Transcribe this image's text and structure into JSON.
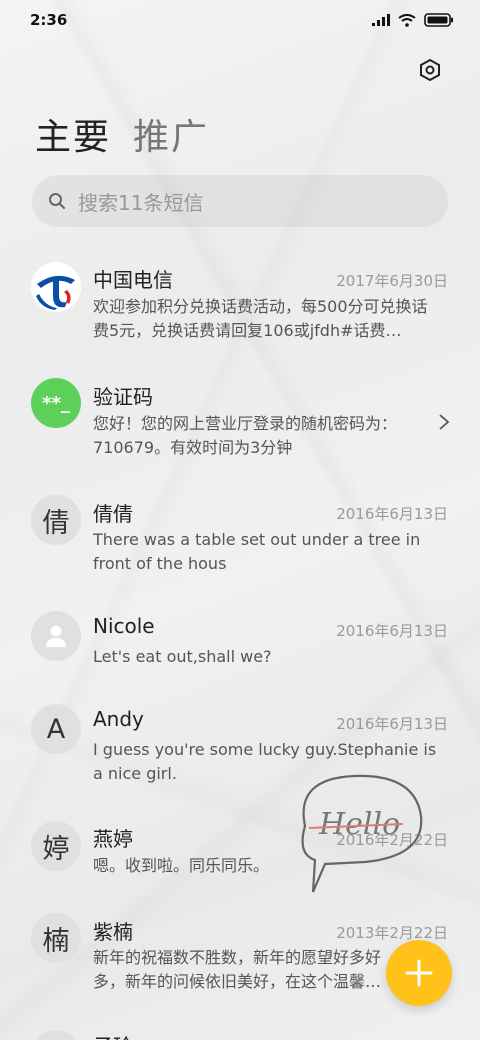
{
  "status_bar": {
    "time": "2:36"
  },
  "header": {
    "tabs": [
      {
        "label": "主要",
        "active": true
      },
      {
        "label": "推广",
        "active": false
      }
    ],
    "settings_icon": "settings-hexagon-icon"
  },
  "search": {
    "placeholder": "搜索11条短信"
  },
  "conversations": [
    {
      "name": "中国电信",
      "date": "2017年6月30日",
      "preview": "欢迎参加积分兑换话费活动，每500分可兑换话费5元，兑换话费请回复106或jfdh#话费…",
      "avatar": "china-telecom-logo"
    },
    {
      "name": "验证码",
      "date": "",
      "preview": "您好！您的网上营业厅登录的随机密码为：710679。有效时间为3分钟",
      "avatar_text": "**_",
      "avatar_color": "#5dd05a"
    },
    {
      "name": "倩倩",
      "date": "2016年6月13日",
      "preview": "There was a table set out under a tree in front of the hous",
      "avatar_text": "倩"
    },
    {
      "name": "Nicole",
      "date": "2016年6月13日",
      "preview": "Let's eat out,shall we?",
      "avatar": "person-icon"
    },
    {
      "name": "Andy",
      "date": "2016年6月13日",
      "preview": "I guess you're some lucky guy.Stephanie is a nice girl.",
      "avatar_text": "A"
    },
    {
      "name": "燕婷",
      "date": "2016年2月22日",
      "preview": "嗯。收到啦。同乐同乐。",
      "avatar_text": "婷"
    },
    {
      "name": "紫楠",
      "date": "2013年2月22日",
      "preview": "新年的祝福数不胜数，新年的愿望好多好多，新年的问候依旧美好，在这个温馨的时",
      "avatar_text": "楠"
    },
    {
      "name": "子玲",
      "date": "",
      "preview": "",
      "avatar_text": ""
    }
  ],
  "doodle_text": "Hello",
  "colors": {
    "fab": "#ffc21a",
    "verify_avatar": "#5dd05a",
    "telecom_blue": "#0a4fa6"
  }
}
